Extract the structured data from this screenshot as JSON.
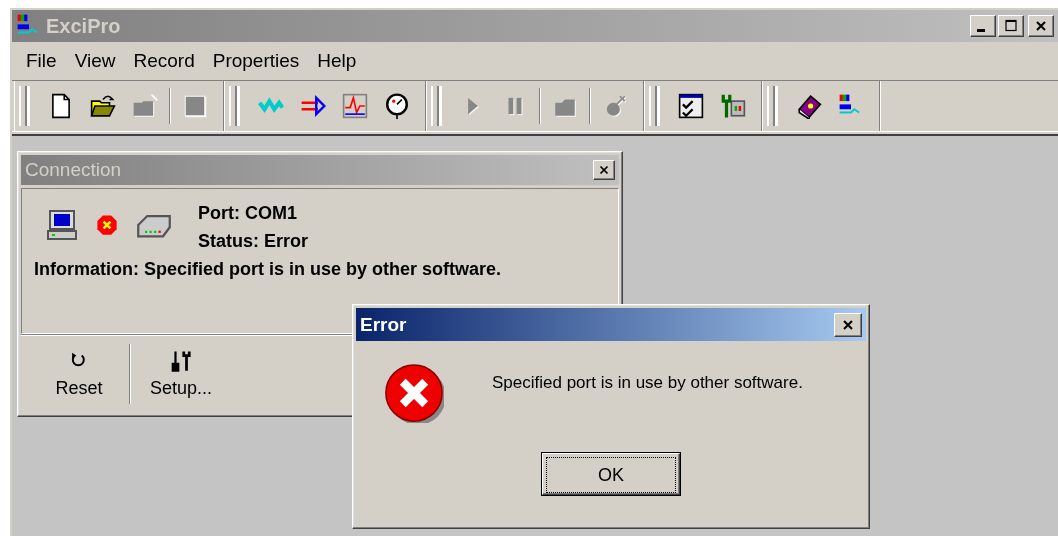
{
  "window": {
    "title": "ExciPro",
    "active": false
  },
  "menu": [
    {
      "label": "File"
    },
    {
      "label": "View"
    },
    {
      "label": "Record"
    },
    {
      "label": "Properties"
    },
    {
      "label": "Help"
    }
  ],
  "toolbar": {
    "bands": [
      {
        "items": [
          {
            "kind": "new",
            "disabled": false,
            "separator_before": false
          },
          {
            "kind": "open",
            "disabled": false,
            "separator_before": false
          },
          {
            "kind": "export",
            "disabled": true,
            "separator_before": false
          },
          {
            "kind": "stop",
            "disabled": true,
            "separator_before": true
          }
        ]
      },
      {
        "items": [
          {
            "kind": "signal",
            "disabled": false,
            "separator_before": false
          },
          {
            "kind": "input",
            "disabled": false,
            "separator_before": false
          },
          {
            "kind": "chart",
            "disabled": false,
            "separator_before": false
          },
          {
            "kind": "gauge",
            "disabled": false,
            "separator_before": false
          }
        ]
      },
      {
        "items": [
          {
            "kind": "play",
            "disabled": true,
            "separator_before": false
          },
          {
            "kind": "pause",
            "disabled": true,
            "separator_before": false
          },
          {
            "kind": "folder",
            "disabled": true,
            "separator_before": true
          },
          {
            "kind": "bomb",
            "disabled": true,
            "separator_before": true
          }
        ]
      },
      {
        "items": [
          {
            "kind": "checklist",
            "disabled": false,
            "separator_before": false
          },
          {
            "kind": "tools",
            "disabled": false,
            "separator_before": false
          }
        ]
      },
      {
        "items": [
          {
            "kind": "help",
            "disabled": false,
            "separator_before": false
          },
          {
            "kind": "logo",
            "disabled": false,
            "separator_before": false
          }
        ]
      }
    ]
  },
  "connection": {
    "title": "Connection",
    "active": false,
    "link_error": true,
    "port": "Port: COM1",
    "status": "Status: Error",
    "information": "Information: Specified port is in use by other software.",
    "buttons": [
      {
        "kind": "reset",
        "label": "Reset"
      },
      {
        "kind": "setup",
        "label": "Setup..."
      }
    ]
  },
  "dialog": {
    "title": "Error",
    "active": true,
    "kind": "error",
    "message": "Specified port is in use by other software.",
    "buttons": [
      {
        "label": "OK",
        "focused": true
      }
    ]
  }
}
